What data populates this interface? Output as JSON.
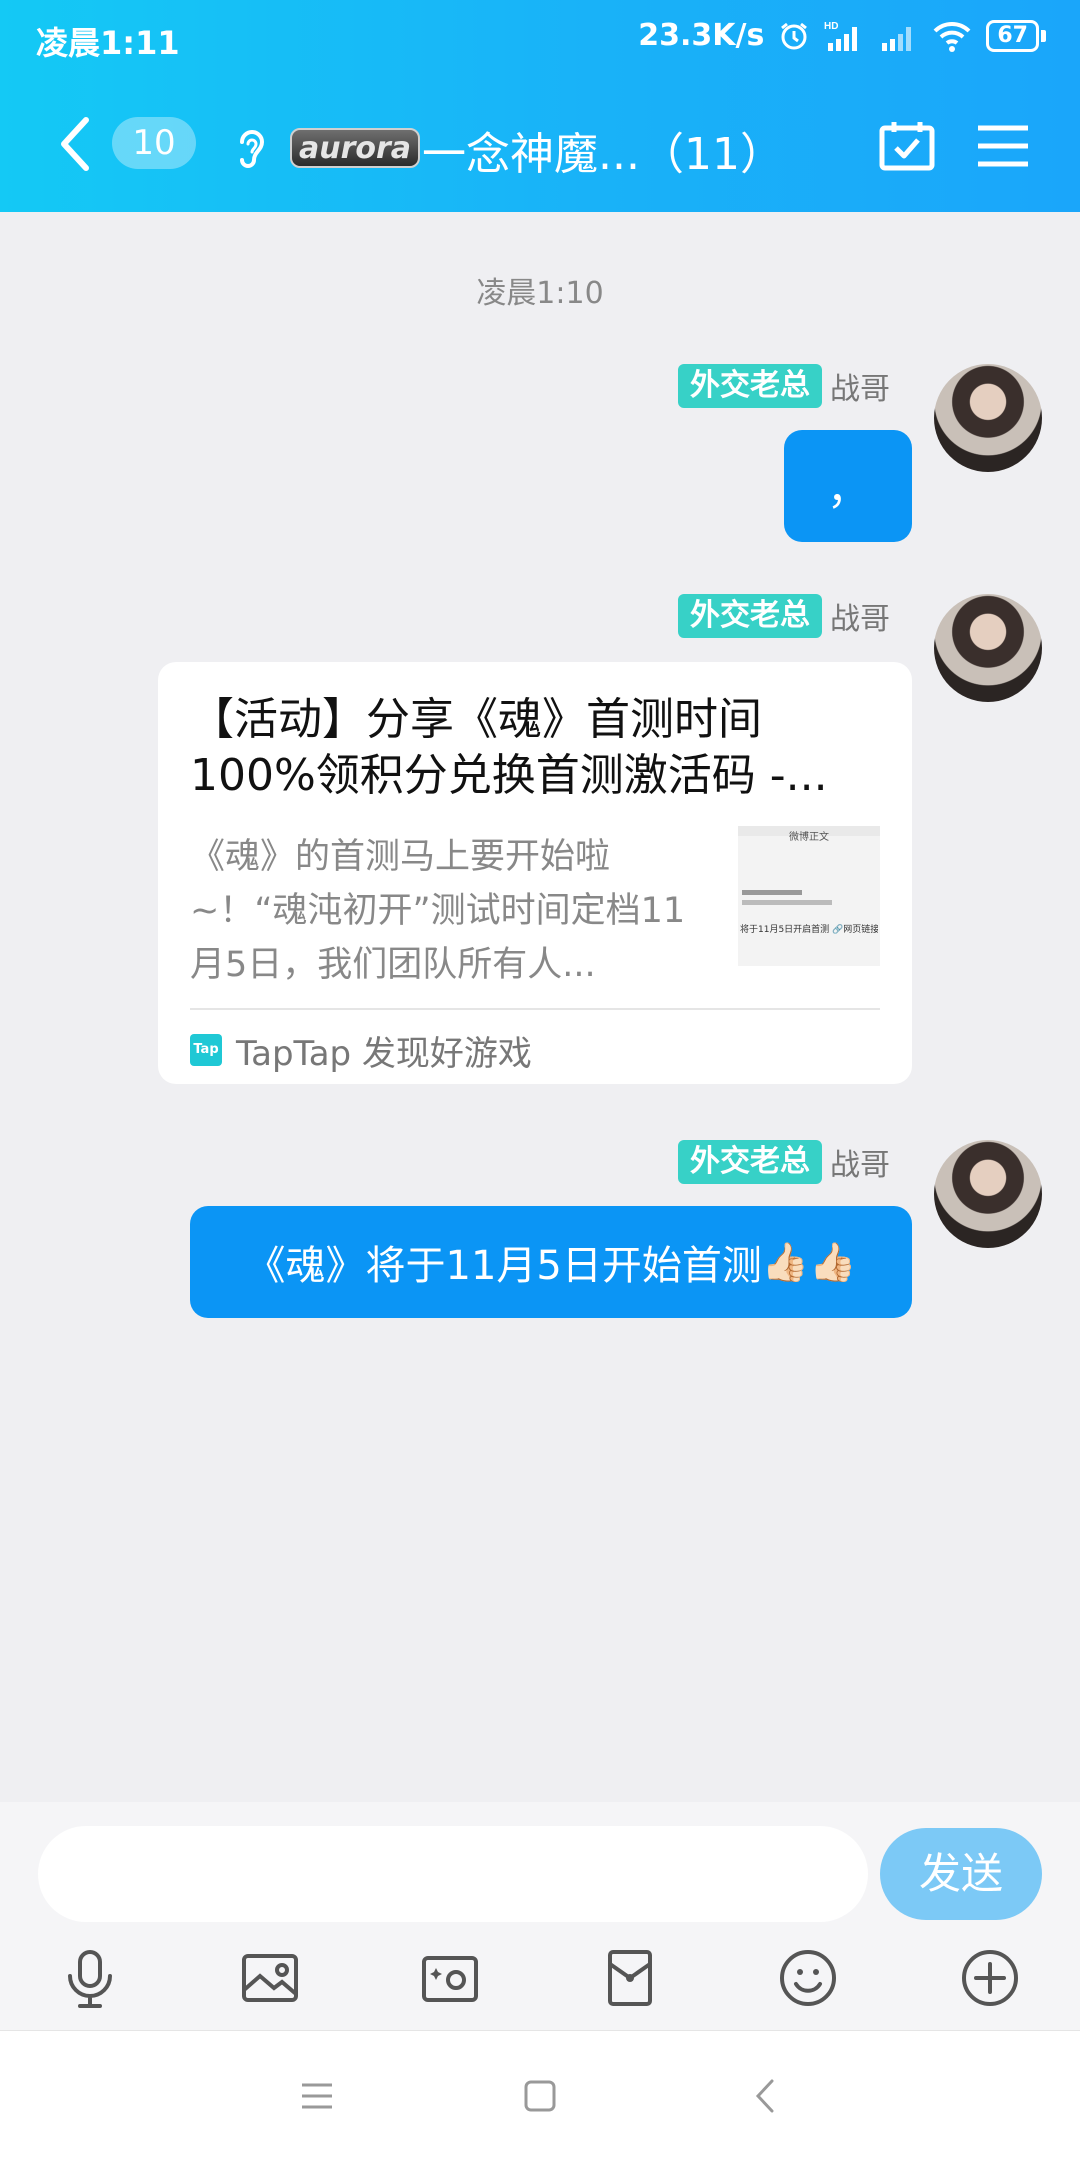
{
  "status_bar": {
    "time": "凌晨1:11",
    "network_speed": "23.3K/s",
    "battery": "67",
    "icons": [
      "alarm-icon",
      "hd-signal-icon",
      "signal-icon",
      "signal-icon",
      "wifi-icon",
      "battery-icon"
    ]
  },
  "header": {
    "unread_count": "10",
    "title": "一念神魔...（11）",
    "logo_text": "aurora"
  },
  "chat": {
    "time_divider": "凌晨1:10",
    "messages": [
      {
        "tag": "外交老总",
        "sender": "战哥",
        "text": "，"
      },
      {
        "tag": "外交老总",
        "sender": "战哥",
        "card": {
          "title": "【活动】分享《魂》首测时间100%领积分兑换首测激活码 -...",
          "description": "《魂》的首测马上要开始啦~！“魂沌初开”测试时间定档11月5日，我们团队所有人...",
          "thumbnail_header": "微博正文",
          "thumbnail_text": "将于11月5日开启首测 🔗网页链接",
          "source_icon": "Tap",
          "source": "TapTap 发现好游戏"
        }
      },
      {
        "tag": "外交老总",
        "sender": "战哥",
        "text": "《魂》将于11月5日开始首测",
        "emoji": "👍🏻👍🏻"
      }
    ]
  },
  "input": {
    "value": "",
    "send_label": "发送"
  },
  "colors": {
    "header_start": "#14c9f5",
    "header_end": "#1aa6fa",
    "bubble": "#0b95f5",
    "tag": "#37d1c7",
    "send_button": "#7cc9f6"
  }
}
